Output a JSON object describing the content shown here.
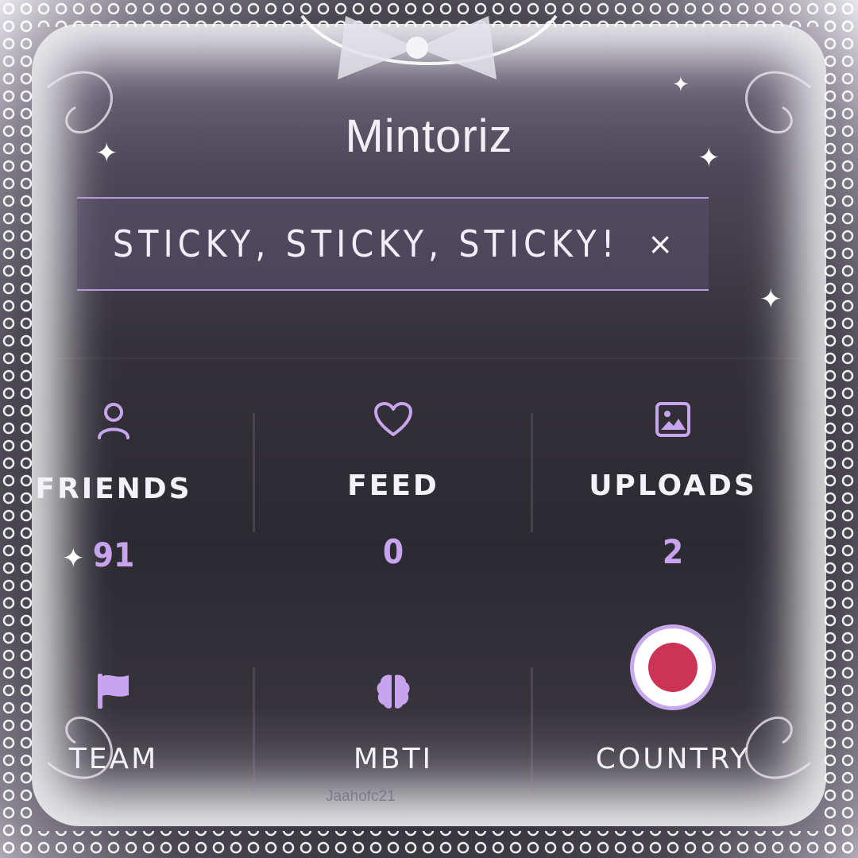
{
  "profile": {
    "name": "Mintoriz"
  },
  "banner": {
    "text": "STICKY, STICKY, STICKY!",
    "close_icon": "×"
  },
  "stats": [
    {
      "icon": "person-icon",
      "label": "FRIENDS",
      "count": "91"
    },
    {
      "icon": "heart-icon",
      "label": "FEED",
      "count": "0"
    },
    {
      "icon": "image-icon",
      "label": "UPLOADS",
      "count": "2"
    }
  ],
  "info": [
    {
      "icon": "flag-icon",
      "label": "TEAM"
    },
    {
      "icon": "brain-icon",
      "label": "MBTI"
    },
    {
      "icon": "country-badge",
      "label": "COUNTRY"
    }
  ],
  "watermark": "Jaahofc21",
  "colors": {
    "accent": "#c9a4ee",
    "country_dot": "#cc3355"
  }
}
